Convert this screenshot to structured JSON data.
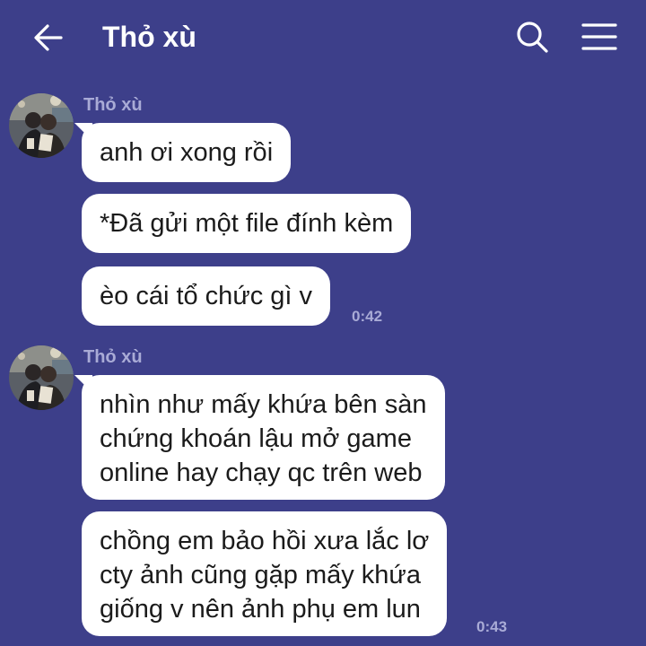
{
  "header": {
    "title": "Thỏ xù",
    "back_icon": "arrow-left-icon",
    "search_icon": "search-icon",
    "menu_icon": "hamburger-menu-icon"
  },
  "conversation": {
    "groups": [
      {
        "sender": "Thỏ xù",
        "messages": [
          {
            "text": "anh ơi xong rồi"
          },
          {
            "text": "*Đã gửi một file đính kèm"
          },
          {
            "text": "èo cái tổ chức gì v"
          }
        ],
        "time": "0:42"
      },
      {
        "sender": "Thỏ xù",
        "messages": [
          {
            "lines": [
              "nhìn như mấy khứa bên sàn",
              "chứng khoán lậu mở game",
              "online hay chạy qc trên web"
            ]
          },
          {
            "lines": [
              "chồng em bảo hồi xưa lắc lơ",
              "cty ảnh cũng gặp mấy khứa",
              "giống v nên ảnh phụ em lun"
            ]
          }
        ],
        "time": "0:43"
      }
    ]
  },
  "colors": {
    "background": "#3d3f8a",
    "bubble": "#ffffff",
    "meta_text": "#a9abd6"
  }
}
